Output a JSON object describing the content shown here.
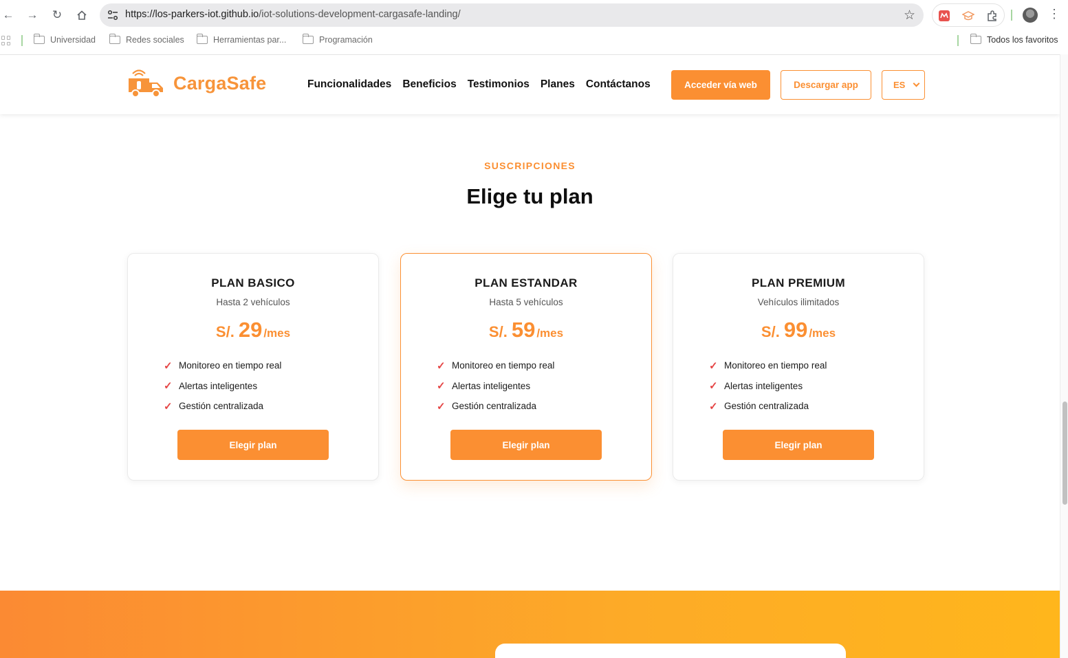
{
  "browser": {
    "url_host": "https://los-parkers-iot.github.io",
    "url_path": "/iot-solutions-development-cargasafe-landing/",
    "bookmarks": [
      "Universidad",
      "Redes sociales",
      "Herramientas par...",
      "Programación"
    ],
    "bookmarks_right": "Todos los favoritos"
  },
  "site": {
    "brand": "CargaSafe",
    "brand_color": "#fb8f32",
    "nav": [
      "Funcionalidades",
      "Beneficios",
      "Testimonios",
      "Planes",
      "Contáctanos"
    ],
    "btn_web": "Acceder vía web",
    "btn_app": "Descargar app",
    "lang": "ES"
  },
  "pricing": {
    "eyebrow": "SUSCRIPCIONES",
    "title": "Elige tu plan",
    "plans": [
      {
        "name": "PLAN BASICO",
        "limit": "Hasta 2 vehículos",
        "currency": "S/.",
        "amount": "29",
        "period": "/mes",
        "features": [
          "Monitoreo en tiempo real",
          "Alertas inteligentes",
          "Gestión centralizada"
        ],
        "cta": "Elegir plan"
      },
      {
        "name": "PLAN ESTANDAR",
        "limit": "Hasta 5 vehículos",
        "currency": "S/.",
        "amount": "59",
        "period": "/mes",
        "features": [
          "Monitoreo en tiempo real",
          "Alertas inteligentes",
          "Gestión centralizada"
        ],
        "cta": "Elegir plan"
      },
      {
        "name": "PLAN PREMIUM",
        "limit": "Vehículos ilimitados",
        "currency": "S/.",
        "amount": "99",
        "period": "/mes",
        "features": [
          "Monitoreo en tiempo real",
          "Alertas inteligentes",
          "Gestión centralizada"
        ],
        "cta": "Elegir plan"
      }
    ]
  }
}
